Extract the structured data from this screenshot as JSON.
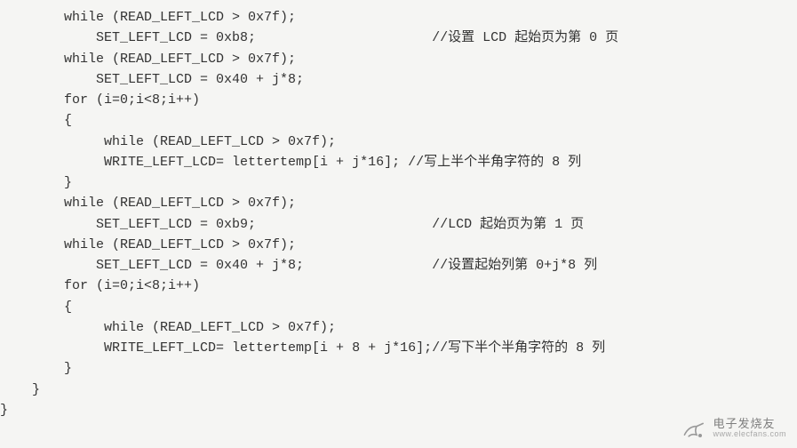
{
  "lines": [
    {
      "code": "        while (READ_LEFT_LCD > 0x7f);",
      "comment": ""
    },
    {
      "code": "            SET_LEFT_LCD = 0xb8;",
      "comment": "                      //设置 LCD 起始页为第 0 页"
    },
    {
      "code": "        while (READ_LEFT_LCD > 0x7f);",
      "comment": ""
    },
    {
      "code": "            SET_LEFT_LCD = 0x40 + j*8;",
      "comment": ""
    },
    {
      "code": "        for (i=0;i<8;i++)",
      "comment": ""
    },
    {
      "code": "        {",
      "comment": ""
    },
    {
      "code": "             while (READ_LEFT_LCD > 0x7f);",
      "comment": ""
    },
    {
      "code": "             WRITE_LEFT_LCD= lettertemp[i + j*16];",
      "comment": " //写上半个半角字符的 8 列"
    },
    {
      "code": "        }",
      "comment": ""
    },
    {
      "code": "        while (READ_LEFT_LCD > 0x7f);",
      "comment": ""
    },
    {
      "code": "            SET_LEFT_LCD = 0xb9;",
      "comment": "                      //LCD 起始页为第 1 页"
    },
    {
      "code": "        while (READ_LEFT_LCD > 0x7f);",
      "comment": ""
    },
    {
      "code": "            SET_LEFT_LCD = 0x40 + j*8;",
      "comment": "                //设置起始列第 0+j*8 列"
    },
    {
      "code": "        for (i=0;i<8;i++)",
      "comment": ""
    },
    {
      "code": "        {",
      "comment": ""
    },
    {
      "code": "             while (READ_LEFT_LCD > 0x7f);",
      "comment": ""
    },
    {
      "code": "             WRITE_LEFT_LCD= lettertemp[i + 8 + j*16];",
      "comment": "//写下半个半角字符的 8 列"
    },
    {
      "code": "        }",
      "comment": ""
    },
    {
      "code": "    }",
      "comment": ""
    },
    {
      "code": "}",
      "comment": ""
    }
  ],
  "watermark": {
    "cn": "电子发烧友",
    "en": "www.elecfans.com"
  }
}
